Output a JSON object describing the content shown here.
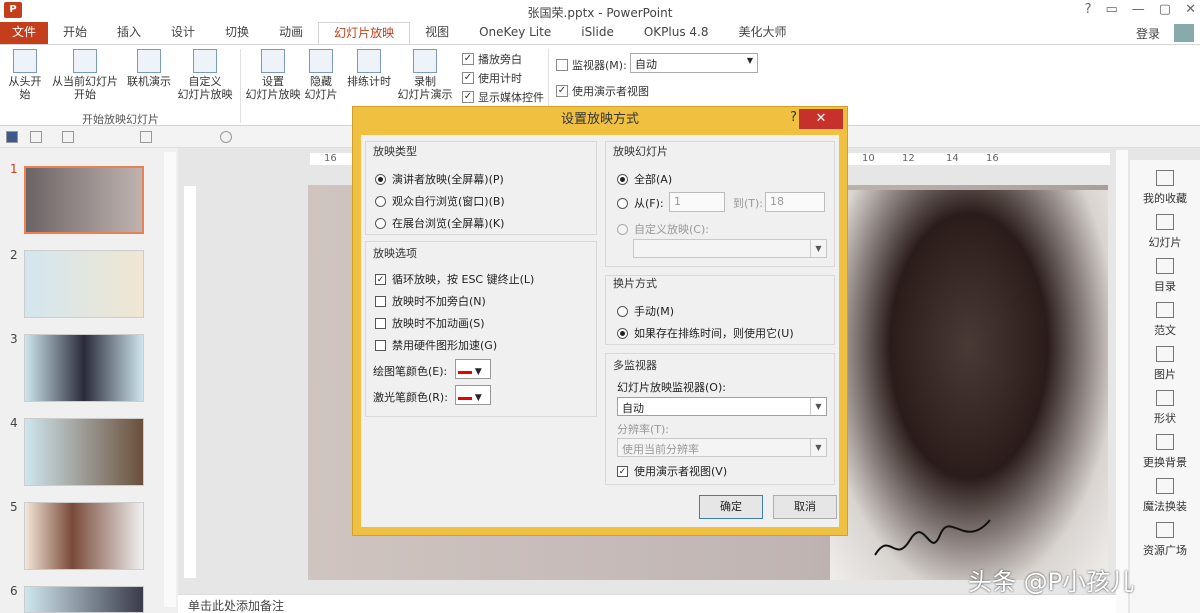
{
  "window": {
    "title": "张国荣.pptx - PowerPoint",
    "app_logo": "P",
    "controls": [
      "?",
      "▭",
      "—",
      "▢",
      "✕"
    ]
  },
  "tabs": [
    "文件",
    "开始",
    "插入",
    "设计",
    "切换",
    "动画",
    "幻灯片放映",
    "视图",
    "OneKey Lite",
    "iSlide",
    "OKPlus 4.8",
    "美化大师"
  ],
  "login": "登录",
  "ribbon": {
    "from_start": "从头开始",
    "from_current_l1": "从当前幻灯片",
    "from_current_l2": "开始",
    "online_l1": "联机演示",
    "custom_l1": "自定义",
    "custom_l2": "幻灯片放映",
    "group1": "开始放映幻灯片",
    "setup_l1": "设置",
    "setup_l2": "幻灯片放映",
    "hide_l1": "隐藏",
    "hide_l2": "幻灯片",
    "rehearse": "排练计时",
    "record_l1": "录制",
    "record_l2": "幻灯片演示",
    "chk_narration": "播放旁白",
    "chk_timings": "使用计时",
    "chk_media": "显示媒体控件",
    "monitor_label": "监视器(M):",
    "monitor_value": "自动",
    "presenter_view": "使用演示者视图"
  },
  "slides": [
    "1",
    "2",
    "3",
    "4",
    "5",
    "6"
  ],
  "notes_placeholder": "单击此处添加备注",
  "right_pane": [
    "我的收藏",
    "幻灯片",
    "目录",
    "范文",
    "图片",
    "形状",
    "更换背景",
    "魔法换装",
    "资源广场"
  ],
  "watermark": "头条 @P小孩儿",
  "ruler": {
    "l1": "16",
    "r1": "10",
    "r2": "12",
    "r3": "14",
    "r4": "16"
  },
  "dialog": {
    "title": "设置放映方式",
    "help": "?",
    "close": "✕",
    "show_type": {
      "legend": "放映类型",
      "opt1": "演讲者放映(全屏幕)(P)",
      "opt2": "观众自行浏览(窗口)(B)",
      "opt3": "在展台浏览(全屏幕)(K)"
    },
    "show_options": {
      "legend": "放映选项",
      "opt1": "循环放映，按 ESC 键终止(L)",
      "opt2": "放映时不加旁白(N)",
      "opt3": "放映时不加动画(S)",
      "opt4": "禁用硬件图形加速(G)",
      "pen_color": "绘图笔颜色(E):",
      "laser_color": "激光笔颜色(R):"
    },
    "show_slides": {
      "legend": "放映幻灯片",
      "all": "全部(A)",
      "from": "从(F):",
      "from_value": "1",
      "to": "到(T):",
      "to_value": "18",
      "custom": "自定义放映(C):"
    },
    "advance": {
      "legend": "换片方式",
      "manual": "手动(M)",
      "timings": "如果存在排练时间，则使用它(U)"
    },
    "multi_monitor": {
      "legend": "多监视器",
      "monitor_label": "幻灯片放映监视器(O):",
      "monitor_value": "自动",
      "resolution_label": "分辨率(T):",
      "resolution_value": "使用当前分辨率",
      "presenter": "使用演示者视图(V)"
    },
    "ok": "确定",
    "cancel": "取消"
  }
}
